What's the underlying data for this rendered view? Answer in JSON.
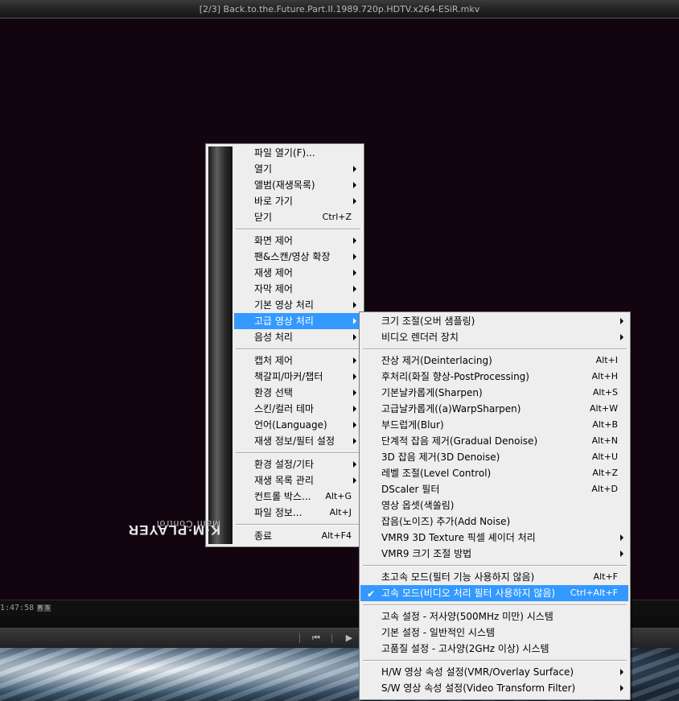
{
  "window": {
    "title": "[2/3] Back.to.the.Future.Part.II.1989.720p.HDTV.x264-ESiR.mkv"
  },
  "status": {
    "time": "1:47:58",
    "badges": [
      "R",
      "S"
    ]
  },
  "controls": [
    {
      "icon": "skip-previous-icon",
      "glyph": "⏮"
    },
    {
      "icon": "play-icon",
      "glyph": "▶"
    }
  ],
  "sidebar": {
    "brand": "K·M·PLAYER",
    "subtitle": "Main Control"
  },
  "colors": {
    "highlight": "#3399ff",
    "menu_bg": "#eeeeee",
    "video_bg": "#130510"
  },
  "main_menu": {
    "items": [
      {
        "label": "파일 열기(F)...",
        "shortcut": "",
        "submenu": false
      },
      {
        "label": "열기",
        "shortcut": "",
        "submenu": true
      },
      {
        "label": "앨범(재생목록)",
        "shortcut": "",
        "submenu": true
      },
      {
        "label": "바로 가기",
        "shortcut": "",
        "submenu": true
      },
      {
        "label": "닫기",
        "shortcut": "Ctrl+Z",
        "submenu": false
      },
      {
        "label": "화면 제어",
        "shortcut": "",
        "submenu": true
      },
      {
        "label": "팬&스캔/영상 확장",
        "shortcut": "",
        "submenu": true
      },
      {
        "label": "재생 제어",
        "shortcut": "",
        "submenu": true
      },
      {
        "label": "자막 제어",
        "shortcut": "",
        "submenu": true
      },
      {
        "label": "기본 영상 처리",
        "shortcut": "",
        "submenu": true
      },
      {
        "label": "고급 영상 처리",
        "shortcut": "",
        "submenu": true,
        "highlighted": true
      },
      {
        "label": "음성 처리",
        "shortcut": "",
        "submenu": true
      },
      {
        "label": "캡처 제어",
        "shortcut": "",
        "submenu": true
      },
      {
        "label": "책갈피/마커/챕터",
        "shortcut": "",
        "submenu": true
      },
      {
        "label": "환경 선택",
        "shortcut": "",
        "submenu": true
      },
      {
        "label": "스킨/컬러 테마",
        "shortcut": "",
        "submenu": true
      },
      {
        "label": "언어(Language)",
        "shortcut": "",
        "submenu": true
      },
      {
        "label": "재생 정보/필터 설정",
        "shortcut": "",
        "submenu": true
      },
      {
        "label": "환경 설정/기타",
        "shortcut": "",
        "submenu": true
      },
      {
        "label": "재생 목록 관리",
        "shortcut": "",
        "submenu": true
      },
      {
        "label": "컨트롤 박스...",
        "shortcut": "Alt+G",
        "submenu": false
      },
      {
        "label": "파일 정보...",
        "shortcut": "Alt+J",
        "submenu": false
      },
      {
        "label": "종료",
        "shortcut": "Alt+F4",
        "submenu": false
      }
    ]
  },
  "sub_menu": {
    "items": [
      {
        "label": "크기 조절(오버 샘플링)",
        "shortcut": "",
        "submenu": true
      },
      {
        "label": "비디오 렌더러 장치",
        "shortcut": "",
        "submenu": true
      },
      {
        "label": "잔상 제거(Deinterlacing)",
        "shortcut": "Alt+I",
        "submenu": false
      },
      {
        "label": "후처리(화질 향상-PostProcessing)",
        "shortcut": "Alt+H",
        "submenu": false
      },
      {
        "label": "기본날카롭게(Sharpen)",
        "shortcut": "Alt+S",
        "submenu": false
      },
      {
        "label": "고급날카롭게((a)WarpSharpen)",
        "shortcut": "Alt+W",
        "submenu": false
      },
      {
        "label": "부드럽게(Blur)",
        "shortcut": "Alt+B",
        "submenu": false
      },
      {
        "label": "단계적 잡음 제거(Gradual Denoise)",
        "shortcut": "Alt+N",
        "submenu": false
      },
      {
        "label": "3D 잡음 제거(3D Denoise)",
        "shortcut": "Alt+U",
        "submenu": false
      },
      {
        "label": "레벨 조절(Level Control)",
        "shortcut": "Alt+Z",
        "submenu": false
      },
      {
        "label": "DScaler 필터",
        "shortcut": "Alt+D",
        "submenu": false
      },
      {
        "label": "영상 옵셋(색쏠림)",
        "shortcut": "",
        "submenu": false
      },
      {
        "label": "잡음(노이즈) 추가(Add Noise)",
        "shortcut": "",
        "submenu": false
      },
      {
        "label": "VMR9 3D Texture 픽셀 셰이더 처리",
        "shortcut": "",
        "submenu": true
      },
      {
        "label": "VMR9 크기 조절 방법",
        "shortcut": "",
        "submenu": true
      },
      {
        "label": "초고속 모드(필터 기능 사용하지 않음)",
        "shortcut": "Alt+F",
        "submenu": false
      },
      {
        "label": "고속 모드(비디오 처리 필터 사용하지 않음)",
        "shortcut": "Ctrl+Alt+F",
        "submenu": false,
        "checked": true,
        "highlighted": true
      },
      {
        "label": "고속 설정 - 저사양(500MHz 미만) 시스템",
        "shortcut": "",
        "submenu": false
      },
      {
        "label": "기본 설정 - 일반적인 시스템",
        "shortcut": "",
        "submenu": false
      },
      {
        "label": "고품질 설정 - 고사양(2GHz 이상) 시스템",
        "shortcut": "",
        "submenu": false
      },
      {
        "label": "H/W 영상 속성 설정(VMR/Overlay Surface)",
        "shortcut": "",
        "submenu": true
      },
      {
        "label": "S/W 영상 속성 설정(Video Transform Filter)",
        "shortcut": "",
        "submenu": true
      }
    ]
  }
}
